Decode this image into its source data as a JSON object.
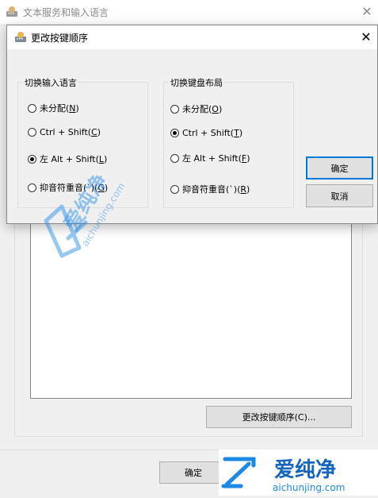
{
  "back_window": {
    "title": "文本服务和输入语言",
    "change_sequence_label": "更改按键顺序(C)...",
    "ok_label": "确定"
  },
  "dialog": {
    "title": "更改按键顺序",
    "input_group": {
      "label": "切换输入语言",
      "options": [
        {
          "text": "未分配(",
          "key": "N",
          "tail": ")",
          "checked": false
        },
        {
          "text": "Ctrl + Shift(",
          "key": "C",
          "tail": ")",
          "checked": false
        },
        {
          "text": "左 Alt + Shift(",
          "key": "L",
          "tail": ")",
          "checked": true
        },
        {
          "text": "抑音符重音(`)(",
          "key": "G",
          "tail": ")",
          "checked": false
        }
      ]
    },
    "keyboard_group": {
      "label": "切换键盘布局",
      "options": [
        {
          "text": "未分配(",
          "key": "O",
          "tail": ")",
          "checked": false
        },
        {
          "text": "Ctrl + Shift(",
          "key": "T",
          "tail": ")",
          "checked": true
        },
        {
          "text": "左 Alt + Shift(",
          "key": "F",
          "tail": ")",
          "checked": false
        },
        {
          "text": "抑音符重音(`)(",
          "key": "R",
          "tail": ")",
          "checked": false
        }
      ]
    },
    "ok_label": "确定",
    "cancel_label": "取消"
  },
  "watermark": {
    "brand": "爱纯净",
    "url": "aichunjing.com",
    "accent": "#1e88e5"
  },
  "icons": {
    "close": "close-icon",
    "app": "keyboard-globe-icon"
  }
}
